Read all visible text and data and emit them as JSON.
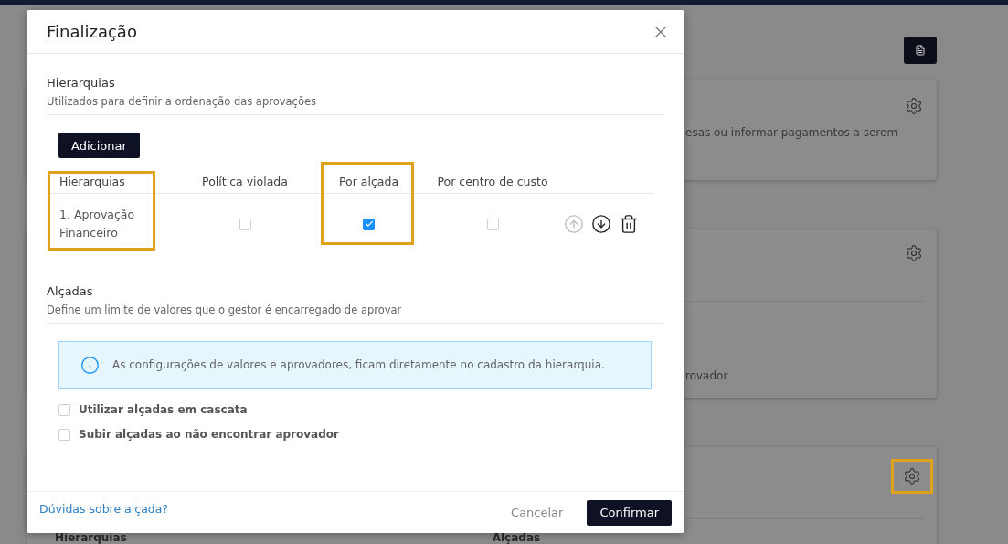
{
  "background": {
    "cards": [
      {
        "kind": "description",
        "gear_highlighted": false,
        "texts": [
          "esas ou informar pagamentos a serem"
        ]
      },
      {
        "kind": "footer_text",
        "gear_highlighted": false,
        "texts": [
          "rovador"
        ]
      },
      {
        "kind": "columns",
        "gear_highlighted": true,
        "texts": [
          "Hierarquias",
          "Alçadas"
        ]
      }
    ]
  },
  "dialog": {
    "title": "Finalização",
    "hierarchies": {
      "title": "Hierarquias",
      "subtitle": "Utilizados para definir a ordenação das aprovações",
      "add_button": "Adicionar",
      "columns": [
        {
          "label": "Hierarquias",
          "highlighted": true
        },
        {
          "label": "Política violada",
          "highlighted": false
        },
        {
          "label": "Por alçada",
          "highlighted": true
        },
        {
          "label": "Por centro de custo",
          "highlighted": false
        }
      ],
      "rows": [
        {
          "name": "1. Aprovação Financeiro",
          "checks": [
            {
              "checked": false
            },
            {
              "checked": true
            },
            {
              "checked": false
            }
          ],
          "actions": [
            {
              "kind": "up",
              "disabled": true
            },
            {
              "kind": "down",
              "disabled": false
            },
            {
              "kind": "delete",
              "disabled": false
            }
          ]
        }
      ]
    },
    "limits": {
      "title": "Alçadas",
      "subtitle": "Define um limite de valores que o gestor é encarregado de aprovar",
      "info": "As configurações de valores e aprovadores, ficam diretamente no cadastro da hierarquia.",
      "options": [
        {
          "label": "Utilizar alçadas em cascata",
          "checked": false
        },
        {
          "label": "Subir alçadas ao não encontrar aprovador",
          "checked": false
        }
      ]
    },
    "footer": {
      "help_link": "Dúvidas sobre alçada?",
      "cancel": "Cancelar",
      "confirm": "Confirmar"
    }
  }
}
